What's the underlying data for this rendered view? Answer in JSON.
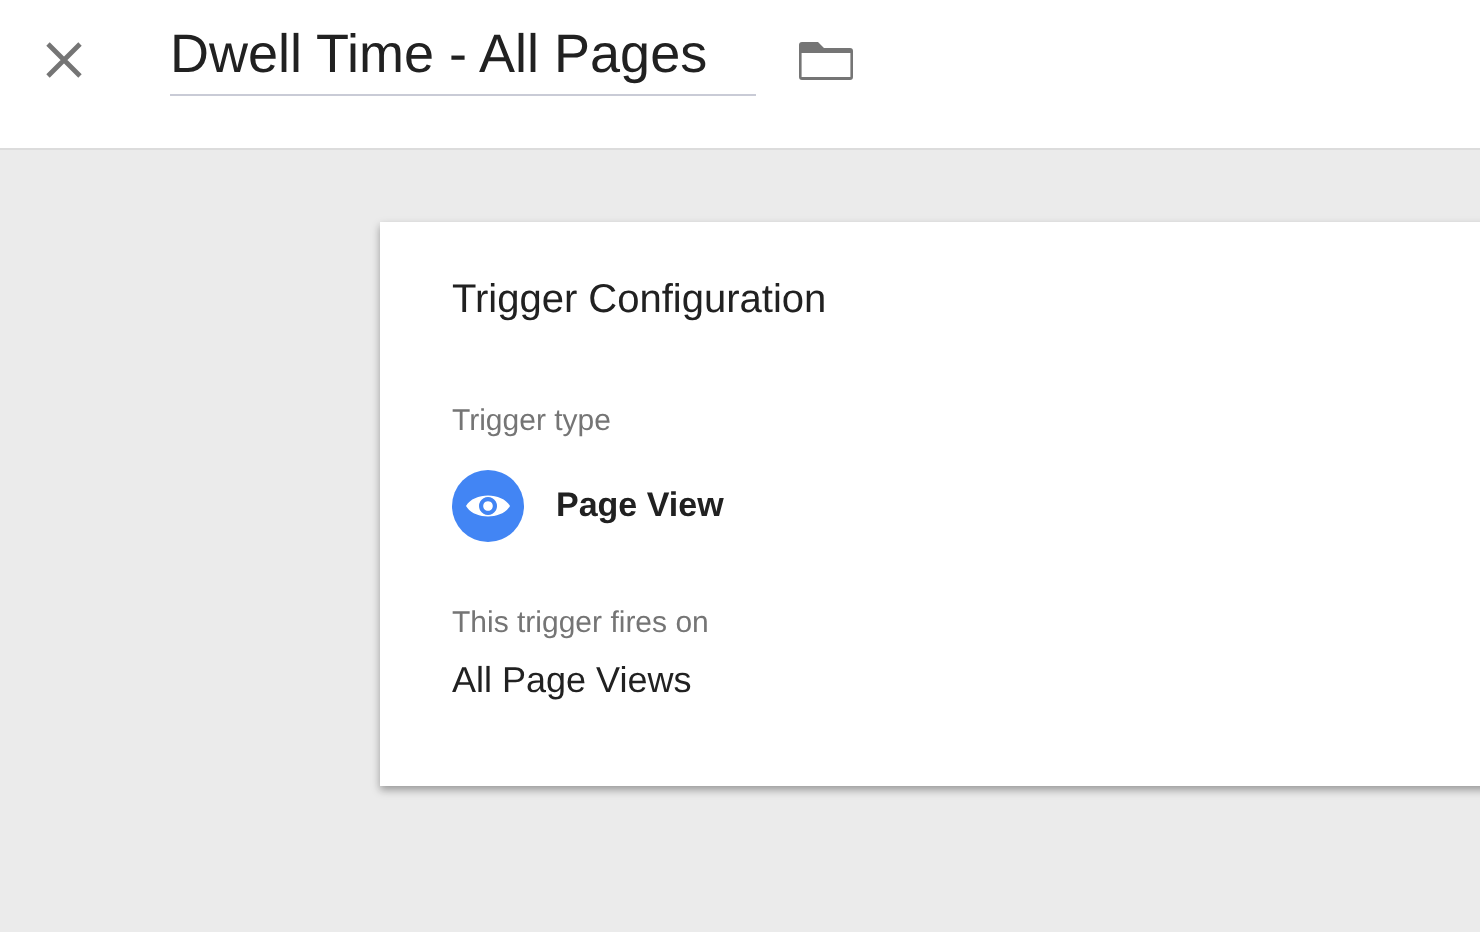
{
  "header": {
    "title": "Dwell Time - All Pages"
  },
  "card": {
    "title": "Trigger Configuration",
    "type_label": "Trigger type",
    "trigger_type": "Page View",
    "fires_label": "This trigger fires on",
    "fires_on": "All Page Views"
  }
}
